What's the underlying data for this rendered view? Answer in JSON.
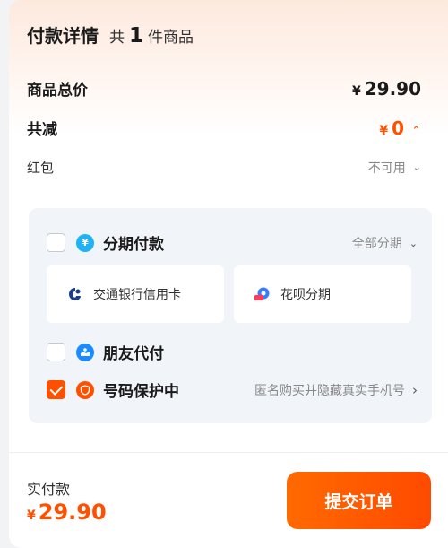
{
  "header": {
    "title": "付款详情",
    "count_prefix": "共",
    "count": "1",
    "count_suffix": "件商品"
  },
  "summary": {
    "total_label": "商品总价",
    "total_currency": "¥",
    "total_value": "29.90",
    "discount_label": "共减",
    "discount_currency": "¥",
    "discount_value": "0",
    "redpacket_label": "红包",
    "redpacket_value": "不可用"
  },
  "payment_options": {
    "installment": {
      "title": "分期付款",
      "right_text": "全部分期",
      "checked": false,
      "cards": [
        {
          "label": "交通银行信用卡",
          "icon": "bocom-logo-icon"
        },
        {
          "label": "花呗分期",
          "icon": "huabei-icon"
        }
      ]
    },
    "friend_pay": {
      "title": "朋友代付",
      "checked": false
    },
    "number_protect": {
      "title": "号码保护中",
      "right_text": "匿名购买并隐藏真实手机号",
      "checked": true
    }
  },
  "footer": {
    "pay_label": "实付款",
    "pay_currency": "¥",
    "pay_value": "29.90",
    "submit_label": "提交订单"
  },
  "colors": {
    "accent": "#ff5000",
    "panel_bg": "#f1f4f9",
    "icon_blue": "#1a8cff"
  }
}
